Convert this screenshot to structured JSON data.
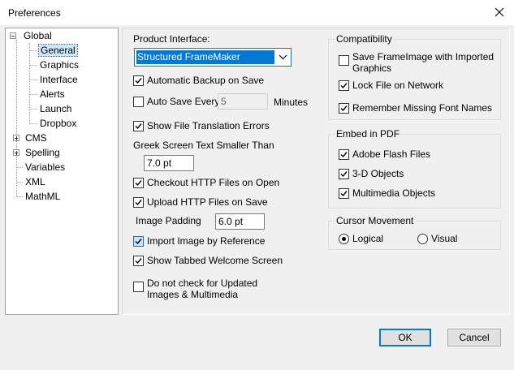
{
  "window": {
    "title": "Preferences"
  },
  "tree": {
    "items": [
      {
        "label": "Global",
        "expander": "minus"
      },
      {
        "label": "General",
        "selected": true
      },
      {
        "label": "Graphics"
      },
      {
        "label": "Interface"
      },
      {
        "label": "Alerts"
      },
      {
        "label": "Launch"
      },
      {
        "label": "Dropbox"
      },
      {
        "label": "CMS",
        "expander": "plus"
      },
      {
        "label": "Spelling",
        "expander": "plus"
      },
      {
        "label": "Variables"
      },
      {
        "label": "XML"
      },
      {
        "label": "MathML"
      }
    ]
  },
  "general": {
    "product_interface_label": "Product Interface:",
    "product_interface_value": "Structured FrameMaker",
    "automatic_backup": {
      "label": "Automatic Backup on Save",
      "checked": true
    },
    "auto_save": {
      "label": "Auto Save Every",
      "checked": false,
      "value": "5",
      "unit": "Minutes"
    },
    "show_translation_errors": {
      "label": "Show File Translation Errors",
      "checked": true
    },
    "greek_label": "Greek Screen Text Smaller Than",
    "greek_value": "7.0 pt",
    "checkout_http": {
      "label": "Checkout HTTP Files on Open",
      "checked": true
    },
    "upload_http": {
      "label": "Upload HTTP Files on Save",
      "checked": true
    },
    "image_padding_label": "Image Padding",
    "image_padding_value": "6.0 pt",
    "import_by_reference": {
      "label": "Import Image by Reference",
      "checked": true
    },
    "tabbed_welcome": {
      "label": "Show Tabbed Welcome Screen",
      "checked": true
    },
    "no_check_updated": {
      "label": "Do not check for Updated Images & Multimedia",
      "checked": false
    }
  },
  "compatibility": {
    "legend": "Compatibility",
    "save_frameimage": {
      "label": "Save FrameImage with Imported Graphics",
      "checked": false
    },
    "lock_file": {
      "label": "Lock File on Network",
      "checked": true
    },
    "remember_fonts": {
      "label": "Remember Missing Font Names",
      "checked": true
    }
  },
  "embed_pdf": {
    "legend": "Embed in PDF",
    "flash": {
      "label": "Adobe Flash Files",
      "checked": true
    },
    "objects_3d": {
      "label": "3-D Objects",
      "checked": true
    },
    "multimedia": {
      "label": "Multimedia Objects",
      "checked": true
    }
  },
  "cursor": {
    "legend": "Cursor Movement",
    "logical": {
      "label": "Logical",
      "selected": true
    },
    "visual": {
      "label": "Visual",
      "selected": false
    }
  },
  "buttons": {
    "ok": "OK",
    "cancel": "Cancel"
  },
  "colors": {
    "accent": "#0078d7",
    "selection": "#cce8ff"
  }
}
